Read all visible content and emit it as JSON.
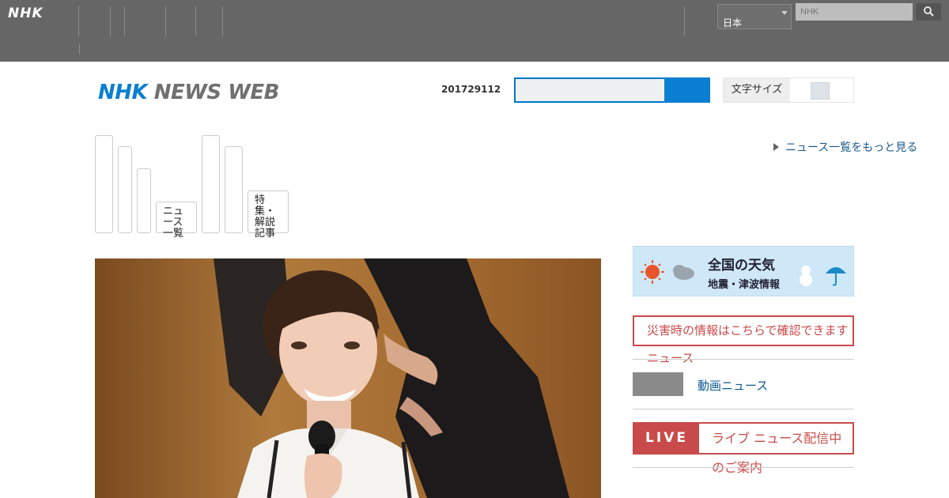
{
  "global_header": {
    "logo": "NHK",
    "language": {
      "selected": "日本"
    },
    "search": {
      "placeholder": "NHK"
    }
  },
  "news_header": {
    "logo_nhk": "NHK",
    "logo_news_web": "NEWS WEB",
    "date": "201729112",
    "utility_label": "文字サイズ"
  },
  "categories": [
    {
      "label": ""
    },
    {
      "label": ""
    },
    {
      "label": ""
    },
    {
      "label": "ニュース一覧"
    },
    {
      "label": ""
    },
    {
      "label": ""
    },
    {
      "label": "特集・解説記事"
    }
  ],
  "more_link": "ニュース一覧をもっと見る",
  "weather_banner": {
    "title": "全国の天気",
    "subtitle": "地震・津波情報"
  },
  "alert_link": "災害時の情報はこちらで確認できますニュース",
  "video_link": "動画ニュース",
  "live": {
    "badge": "LIVE",
    "text": "ライブ ニュース配信中のご案内"
  },
  "colors": {
    "topbar": "#666666",
    "brand_blue": "#0a7fd1",
    "alert_red": "#c84a4a"
  }
}
